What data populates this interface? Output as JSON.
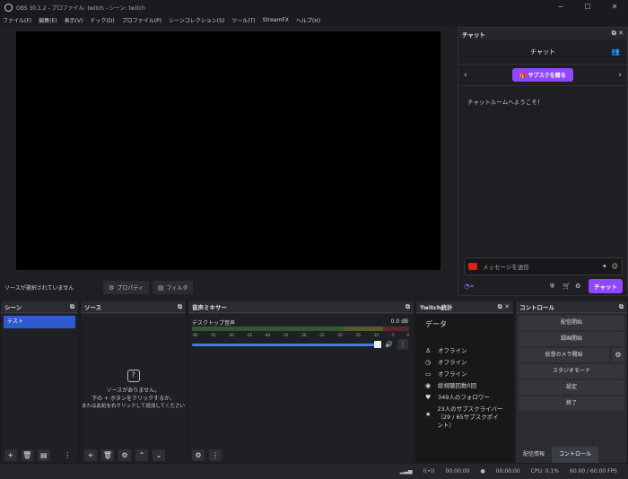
{
  "window": {
    "title": "OBS 30.1.2 - プロファイル: twitch - シーン: twitch",
    "min": "─",
    "max": "☐",
    "close": "✕"
  },
  "menu": [
    "ファイル(F)",
    "編集(E)",
    "表示(V)",
    "ドック(D)",
    "プロファイル(P)",
    "シーンコレクション(S)",
    "ツール(T)",
    "StreamFX",
    "ヘルプ(H)"
  ],
  "preview": {
    "no_source": "ソースが選択されていません",
    "properties": "プロパティ",
    "filters": "フィルタ"
  },
  "chat": {
    "dock_title": "チャット",
    "header": "チャット",
    "subscribe": "サブスクを贈る",
    "welcome": "チャットルームへようこそ！",
    "placeholder": "メッセージを送信",
    "points": "∞",
    "send": "チャット"
  },
  "scenes": {
    "title": "シーン",
    "items": [
      "テスト"
    ]
  },
  "sources": {
    "title": "ソース",
    "empty_lines": [
      "ソースがありません。",
      "下の + ボタンをクリックするか、",
      "または此処を右クリックして追加してください"
    ]
  },
  "mixer": {
    "title": "音声ミキサー",
    "channel": "デスクトップ音声",
    "db": "0.0 dB",
    "scale": [
      "-60",
      "-55",
      "-50",
      "-45",
      "-40",
      "-35",
      "-30",
      "-25",
      "-20",
      "-15",
      "-10",
      "-5",
      "0"
    ],
    "volume_percent": 100
  },
  "stats": {
    "title": "Twitch統計",
    "heading": "データ",
    "rows": [
      {
        "icon": "person-icon",
        "text": "オフライン"
      },
      {
        "icon": "clock-icon",
        "text": "オフライン"
      },
      {
        "icon": "monitor-icon",
        "text": "オフライン"
      },
      {
        "icon": "eye-icon",
        "text": "総視聴回数0回"
      },
      {
        "icon": "heart-icon",
        "text": "349人のフォロワー"
      },
      {
        "icon": "star-icon",
        "text": "23人のサブスクライバー（29 / 65サブスクポイント）"
      }
    ]
  },
  "controls": {
    "title": "コントロール",
    "buttons": [
      "配信開始",
      "録画開始",
      "仮想カメラ開始",
      "スタジオモード",
      "設定",
      "終了"
    ],
    "tabs": [
      "配信情報",
      "コントロール"
    ]
  },
  "statusbar": {
    "stream_time": "00:00:00",
    "rec_time": "00:00:00",
    "cpu": "CPU: 0.1%",
    "fps": "60.00 / 60.00 FPS"
  },
  "colors": {
    "accent": "#9147ff",
    "selection": "#2f5bd1",
    "volume": "#3b7df0"
  }
}
